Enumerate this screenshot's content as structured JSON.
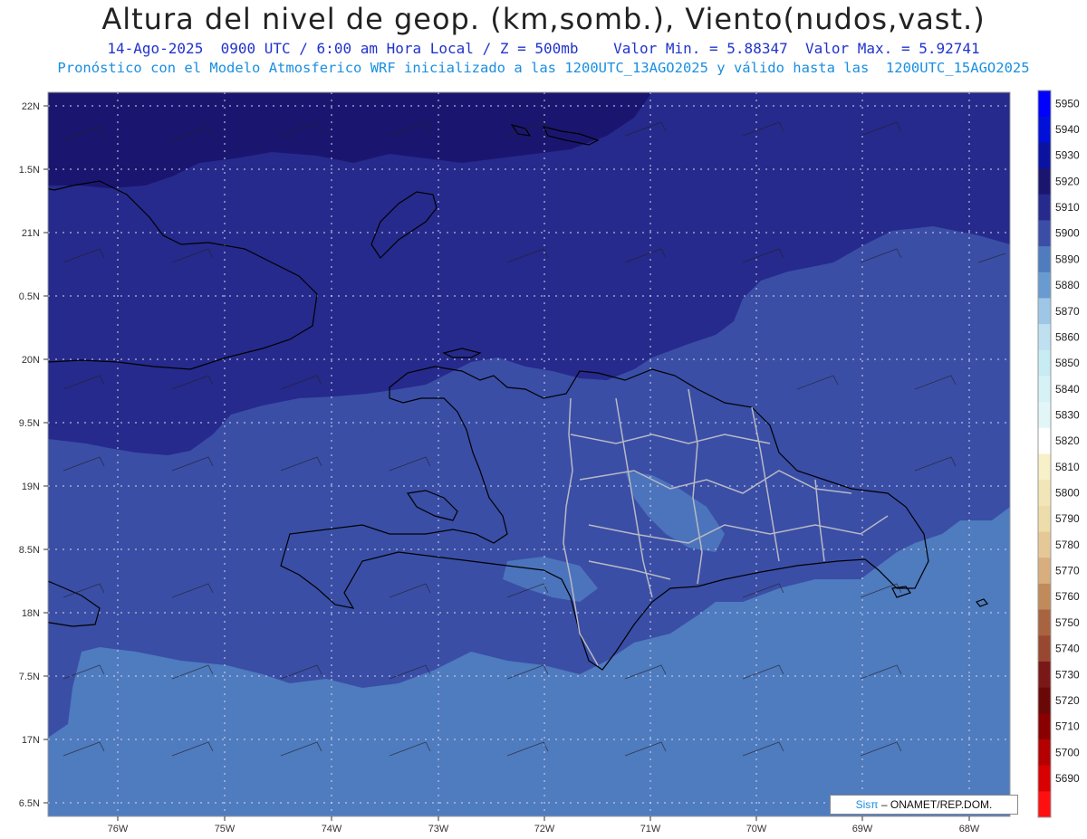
{
  "header": {
    "title": "Altura del nivel de geop. (km,somb.), Viento(nudos,vast.)",
    "subtitle": "14-Ago-2025  0900 UTC / 6:00 am Hora Local / Z = 500mb    Valor Min. = 5.88347  Valor Max. = 5.92741",
    "model_note": "Pronóstico con el Modelo Atmosferico WRF inicializado a las 1200UTC_13AGO2025 y válido hasta las  1200UTC_15AGO2025"
  },
  "axes": {
    "lat_labels": [
      "22N",
      "1.5N",
      "21N",
      "0.5N",
      "20N",
      "9.5N",
      "19N",
      "8.5N",
      "18N",
      "7.5N",
      "17N",
      "6.5N"
    ],
    "lon_labels": [
      "76W",
      "75W",
      "74W",
      "73W",
      "72W",
      "71W",
      "70W",
      "69W",
      "68W"
    ]
  },
  "colorbar": {
    "levels": [
      "5950",
      "5940",
      "5930",
      "5920",
      "5910",
      "5900",
      "5890",
      "5880",
      "5870",
      "5860",
      "5850",
      "5840",
      "5830",
      "5820",
      "5810",
      "5800",
      "5790",
      "5780",
      "5770",
      "5760",
      "5750",
      "5740",
      "5730",
      "5720",
      "5710",
      "5700",
      "5690"
    ],
    "colors": [
      "#0000ff",
      "#0010d8",
      "#0a12a0",
      "#1a1670",
      "#262a8c",
      "#3a4ea6",
      "#4f7bbf",
      "#6a9bd0",
      "#9ec6e6",
      "#bfe0f0",
      "#c8ecf4",
      "#d6f2f6",
      "#e2f6f8",
      "#ffffff",
      "#f8f0c8",
      "#f2e6b8",
      "#eedcaa",
      "#e6c898",
      "#d8ae7e",
      "#c08a5a",
      "#a86440",
      "#984830",
      "#7a1818",
      "#6a0808",
      "#8a0000",
      "#b40000",
      "#d80000",
      "#ff1010"
    ]
  },
  "credit": {
    "sis": "Sisπ",
    "org": "– ONAMET/REP.DOM."
  }
}
